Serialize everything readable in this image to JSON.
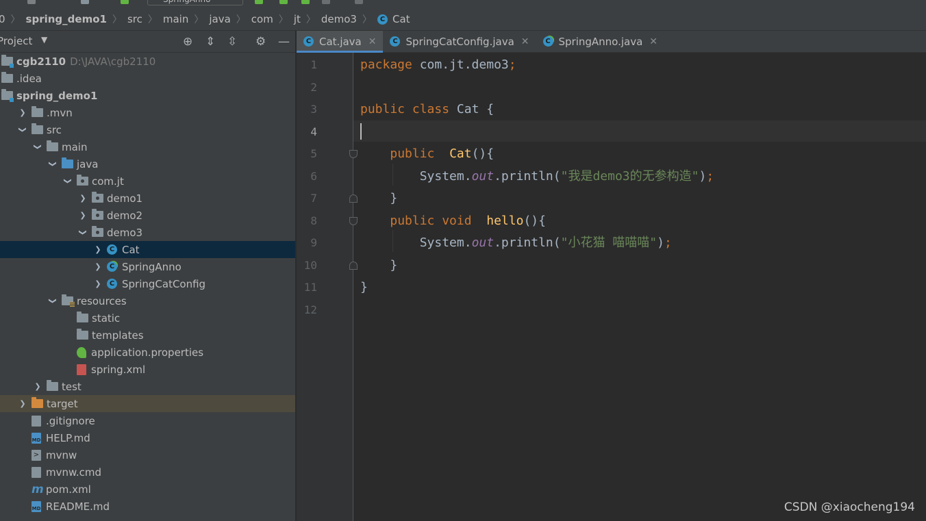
{
  "toolbar": {
    "run_config": "SpringAnno"
  },
  "breadcrumb": [
    {
      "label": "spring_demo1",
      "bold": true
    },
    {
      "label": "src"
    },
    {
      "label": "main"
    },
    {
      "label": "java"
    },
    {
      "label": "com"
    },
    {
      "label": "jt"
    },
    {
      "label": "demo3"
    },
    {
      "label": "Cat",
      "icon": "class-icon"
    }
  ],
  "breadcrumb_lead": "0",
  "project": {
    "title": "Project",
    "tree": [
      {
        "label": "cgb2110",
        "extra": "D:\\JAVA\\cgb2110",
        "depth": 0,
        "icon": "module-folder-icon",
        "arrow": "none",
        "bold": true
      },
      {
        "label": ".idea",
        "depth": 0,
        "icon": "folder-icon",
        "arrow": "none"
      },
      {
        "label": "spring_demo1",
        "depth": 0,
        "icon": "module-folder-icon",
        "arrow": "none",
        "bold": true
      },
      {
        "label": ".mvn",
        "depth": 1,
        "icon": "folder-icon",
        "arrow": "right"
      },
      {
        "label": "src",
        "depth": 1,
        "icon": "folder-icon",
        "arrow": "down"
      },
      {
        "label": "main",
        "depth": 2,
        "icon": "folder-icon",
        "arrow": "down"
      },
      {
        "label": "java",
        "depth": 3,
        "icon": "source-folder-icon",
        "arrow": "down"
      },
      {
        "label": "com.jt",
        "depth": 4,
        "icon": "package-icon",
        "arrow": "down"
      },
      {
        "label": "demo1",
        "depth": 5,
        "icon": "package-icon",
        "arrow": "right"
      },
      {
        "label": "demo2",
        "depth": 5,
        "icon": "package-icon",
        "arrow": "right"
      },
      {
        "label": "demo3",
        "depth": 5,
        "icon": "package-icon",
        "arrow": "down"
      },
      {
        "label": "Cat",
        "depth": 6,
        "icon": "class-icon",
        "arrow": "right",
        "selected": true
      },
      {
        "label": "SpringAnno",
        "depth": 6,
        "icon": "spring-class-icon",
        "arrow": "right"
      },
      {
        "label": "SpringCatConfig",
        "depth": 6,
        "icon": "class-icon",
        "arrow": "right"
      },
      {
        "label": "resources",
        "depth": 3,
        "icon": "resources-folder-icon",
        "arrow": "down"
      },
      {
        "label": "static",
        "depth": 4,
        "icon": "folder-icon",
        "arrow": "none"
      },
      {
        "label": "templates",
        "depth": 4,
        "icon": "folder-icon",
        "arrow": "none"
      },
      {
        "label": "application.properties",
        "depth": 4,
        "icon": "spring-properties-icon",
        "arrow": "none"
      },
      {
        "label": "spring.xml",
        "depth": 4,
        "icon": "xml-file-icon",
        "arrow": "none"
      },
      {
        "label": "test",
        "depth": 2,
        "icon": "folder-icon",
        "arrow": "right"
      },
      {
        "label": "target",
        "depth": 1,
        "icon": "excluded-folder-icon",
        "arrow": "right",
        "excluded": true
      },
      {
        "label": ".gitignore",
        "depth": 1,
        "icon": "gitignore-file-icon",
        "arrow": "none"
      },
      {
        "label": "HELP.md",
        "depth": 1,
        "icon": "markdown-file-icon",
        "arrow": "none"
      },
      {
        "label": "mvnw",
        "depth": 1,
        "icon": "shell-script-icon",
        "arrow": "none"
      },
      {
        "label": "mvnw.cmd",
        "depth": 1,
        "icon": "text-file-icon",
        "arrow": "none"
      },
      {
        "label": "pom.xml",
        "depth": 1,
        "icon": "maven-file-icon",
        "arrow": "none"
      },
      {
        "label": "README.md",
        "depth": 1,
        "icon": "markdown-file-icon",
        "arrow": "none"
      }
    ]
  },
  "tabs": [
    {
      "label": "Cat.java",
      "active": true,
      "icon": "class-icon"
    },
    {
      "label": "SpringCatConfig.java",
      "active": false,
      "icon": "class-icon"
    },
    {
      "label": "SpringAnno.java",
      "active": false,
      "icon": "spring-class-icon"
    }
  ],
  "editor": {
    "current_line": 4,
    "line_numbers": [
      "1",
      "2",
      "3",
      "4",
      "5",
      "6",
      "7",
      "8",
      "9",
      "10",
      "11",
      "12"
    ],
    "lines": [
      [
        {
          "t": "package ",
          "c": "kw"
        },
        {
          "t": "com.jt.demo3"
        },
        {
          "t": ";",
          "c": "semi"
        }
      ],
      [],
      [
        {
          "t": "public ",
          "c": "kw"
        },
        {
          "t": "class ",
          "c": "kw"
        },
        {
          "t": "Cat {"
        }
      ],
      [],
      [
        {
          "t": "    "
        },
        {
          "t": "public  ",
          "c": "kw"
        },
        {
          "t": "Cat",
          "c": "fn"
        },
        {
          "t": "(){"
        }
      ],
      [
        {
          "t": "        System."
        },
        {
          "t": "out",
          "c": "fld"
        },
        {
          "t": ".println("
        },
        {
          "t": "\"我是demo3的无参构造\"",
          "c": "str"
        },
        {
          "t": ")"
        },
        {
          "t": ";",
          "c": "semi"
        }
      ],
      [
        {
          "t": "    }"
        }
      ],
      [
        {
          "t": "    "
        },
        {
          "t": "public ",
          "c": "kw"
        },
        {
          "t": "void  ",
          "c": "kw"
        },
        {
          "t": "hello",
          "c": "fn"
        },
        {
          "t": "(){"
        }
      ],
      [
        {
          "t": "        System."
        },
        {
          "t": "out",
          "c": "fld"
        },
        {
          "t": ".println("
        },
        {
          "t": "\"小花猫 喵喵喵\"",
          "c": "str"
        },
        {
          "t": ")"
        },
        {
          "t": ";",
          "c": "semi"
        }
      ],
      [
        {
          "t": "    }"
        }
      ],
      [
        {
          "t": "}"
        }
      ],
      []
    ]
  },
  "watermark": "CSDN @xiaocheng194",
  "colors": {
    "accent": "#4a88c7",
    "selection": "#0d293e",
    "keyword": "#cc7832",
    "string": "#6a8759",
    "method": "#ffc66d",
    "field": "#9876aa"
  }
}
